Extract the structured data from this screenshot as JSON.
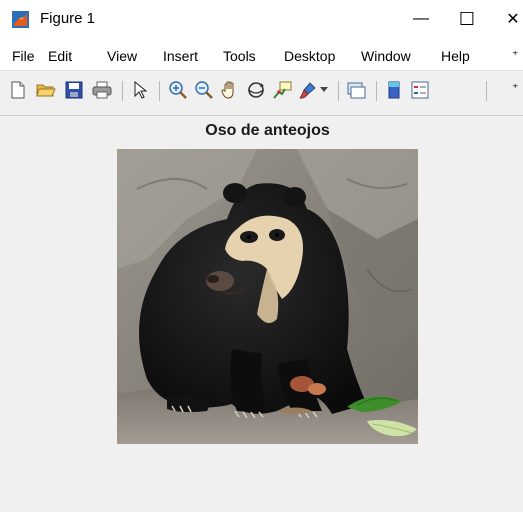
{
  "window": {
    "title": "Figure 1",
    "minimize_glyph": "—",
    "maximize_glyph": "☐",
    "close_glyph": "✕"
  },
  "menu": {
    "items": [
      {
        "label": "File"
      },
      {
        "label": "Edit"
      },
      {
        "label": "View"
      },
      {
        "label": "Insert"
      },
      {
        "label": "Tools"
      },
      {
        "label": "Desktop"
      },
      {
        "label": "Window"
      },
      {
        "label": "Help"
      }
    ],
    "overflow": "⁺"
  },
  "toolbar": {
    "icons": [
      "new-figure-icon",
      "open-file-icon",
      "save-icon",
      "print-icon",
      "pointer-icon",
      "zoom-in-icon",
      "zoom-out-icon",
      "pan-hand-icon",
      "rotate-3d-icon",
      "data-cursor-icon",
      "brush-icon",
      "dropdown-arrow-icon",
      "link-plot-icon",
      "colorbar-icon",
      "legend-icon"
    ],
    "overflow": "⁺"
  },
  "figure": {
    "title": "Oso de anteojos",
    "image_subject": "spectacled bear sitting on rocks"
  },
  "colors": {
    "background": "#f0f0f0",
    "titlebar": "#ffffff",
    "rock": "#8f8c86",
    "bear_fur": "#111111",
    "bear_face_marking": "#e6d2ae",
    "leaf_green": "#3e8e2c"
  }
}
